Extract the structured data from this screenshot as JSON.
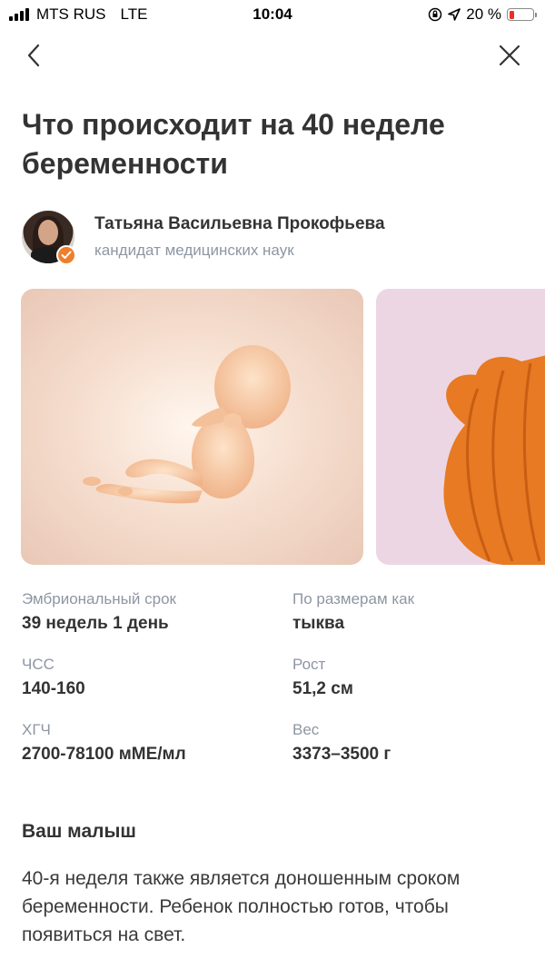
{
  "status_bar": {
    "carrier": "MTS RUS",
    "network": "LTE",
    "time": "10:04",
    "battery_percent": "20 %",
    "battery_level": 0.2,
    "battery_color": "#e8302a"
  },
  "nav": {
    "back_icon": "chevron-left-icon",
    "close_icon": "close-icon"
  },
  "article": {
    "title": "Что происходит на 40 неделе беременности"
  },
  "author": {
    "name": "Татьяна Васильевна Прокофьева",
    "credential": "кандидат медицинских наук",
    "badge_icon": "checkmark-icon",
    "badge_color": "#ef7e2b"
  },
  "carousel": {
    "images": [
      "embryo-illustration",
      "pumpkin-illustration"
    ]
  },
  "stats": [
    {
      "label": "Эмбриональный срок",
      "value": "39 недель 1 день"
    },
    {
      "label": "По размерам как",
      "value": "тыква"
    },
    {
      "label": "ЧСС",
      "value": "140-160"
    },
    {
      "label": "Рост",
      "value": "51,2 см"
    },
    {
      "label": "ХГЧ",
      "value": "2700-78100 мМЕ/мл"
    },
    {
      "label": "Вес",
      "value": "3373–3500 г"
    }
  ],
  "section": {
    "title": "Ваш малыш",
    "body": "40-я неделя также является доношенным сроком беременности. Ребенок полностью готов, чтобы появиться на свет."
  }
}
